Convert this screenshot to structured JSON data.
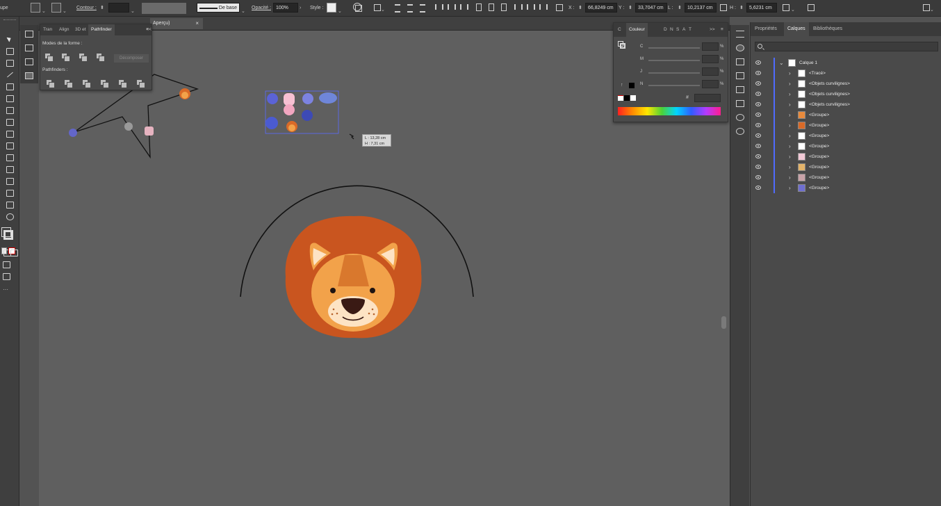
{
  "control_bar": {
    "app_name": "upe",
    "stroke_label": "Contour :",
    "stroke_profile": "De base",
    "opacity_label": "Opacité :",
    "opacity_value": "100%",
    "style_label": "Style :",
    "x_label": "X :",
    "x_value": "66,8249 cm",
    "y_label": "Y :",
    "y_value": "33,7047 cm",
    "w_label": "L :",
    "w_value": "10,2137 cm",
    "h_label": "H :",
    "h_value": "5,6231 cm"
  },
  "document_tab": {
    "label": "Aperçu)",
    "close": "×"
  },
  "pathfinder_panel": {
    "tabs": [
      "Tran",
      "Align",
      "3D et",
      "Pathfinder"
    ],
    "active_tab": "Pathfinder",
    "collapse": "<<",
    "shape_modes_label": "Modes de la forme :",
    "expand_button": "Décomposer",
    "pathfinders_label": "Pathfinders :"
  },
  "canvas": {
    "tooltip_w": "L : 13,28 cm",
    "tooltip_h": "H : 7,31 cm",
    "lion_colors": {
      "mane": "#c9551f",
      "face": "#f2a24a",
      "muzzle": "#fde3c4",
      "nose": "#3a1a14",
      "ear_inner": "#fde3c4"
    },
    "arc_color": "#111111"
  },
  "color_panel": {
    "tabs": [
      "C",
      "Couleur",
      "D",
      "N",
      "S",
      "A",
      "T"
    ],
    "active_tab": "Couleur",
    "collapse": ">>",
    "channels": [
      {
        "label": "C",
        "unit": "%"
      },
      {
        "label": "M",
        "unit": "%"
      },
      {
        "label": "J",
        "unit": "%"
      },
      {
        "label": "N",
        "unit": "%"
      }
    ]
  },
  "layers_panel": {
    "tabs": [
      "Propriétés",
      "Calques",
      "Bibliothèques"
    ],
    "active_tab": "Calques",
    "search_placeholder": "",
    "rows": [
      {
        "name": "Calque 1",
        "level": 0,
        "expanded": true,
        "thumb": "#ffffff"
      },
      {
        "name": "<Tracé>",
        "level": 1,
        "expanded": false,
        "thumb": "#ffffff"
      },
      {
        "name": "<Objets curvilignes>",
        "level": 1,
        "expanded": false,
        "thumb": "#ffffff"
      },
      {
        "name": "<Objets curvilignes>",
        "level": 1,
        "expanded": false,
        "thumb": "#ffffff"
      },
      {
        "name": "<Objets curvilignes>",
        "level": 1,
        "expanded": false,
        "thumb": "#ffffff"
      },
      {
        "name": "<Groupe>",
        "level": 1,
        "expanded": false,
        "thumb": "#e88a3c"
      },
      {
        "name": "<Groupe>",
        "level": 1,
        "expanded": false,
        "thumb": "#d96a28"
      },
      {
        "name": "<Groupe>",
        "level": 1,
        "expanded": false,
        "thumb": "#ffffff"
      },
      {
        "name": "<Groupe>",
        "level": 1,
        "expanded": false,
        "thumb": "#ffffff"
      },
      {
        "name": "<Groupe>",
        "level": 1,
        "expanded": false,
        "thumb": "#f2c9d6"
      },
      {
        "name": "<Groupe>",
        "level": 1,
        "expanded": false,
        "thumb": "#e3b46a"
      },
      {
        "name": "<Groupe>",
        "level": 1,
        "expanded": false,
        "thumb": "#c9a3a8"
      },
      {
        "name": "<Groupe>",
        "level": 1,
        "expanded": false,
        "thumb": "#6f6fcf"
      }
    ]
  },
  "colors": {
    "layer_stripe": "#4f6bff",
    "selection": "#5a6cff"
  }
}
